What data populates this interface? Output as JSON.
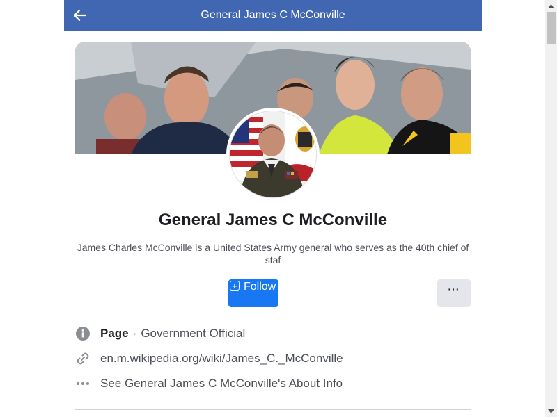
{
  "header": {
    "title": "General James C McConville"
  },
  "profile": {
    "name": "General James C McConville",
    "description": "James Charles McConville is a United States Army general who serves as the 40th chief of staf"
  },
  "actions": {
    "follow_label": "Follow",
    "more_label": "···"
  },
  "info": {
    "category_bold": "Page",
    "category_separator": "·",
    "category_type": "Government Official",
    "website": "en.m.wikipedia.org/wiki/James_C._McConville",
    "about": "See General James C McConville's About Info"
  },
  "colors": {
    "header": "#4267b2",
    "follow": "#1877f2",
    "more_bg": "#e4e6eb"
  },
  "icons": {
    "back": "arrow-left-icon",
    "category": "info-circle-icon",
    "website": "link-icon",
    "about": "more-dots-icon"
  }
}
